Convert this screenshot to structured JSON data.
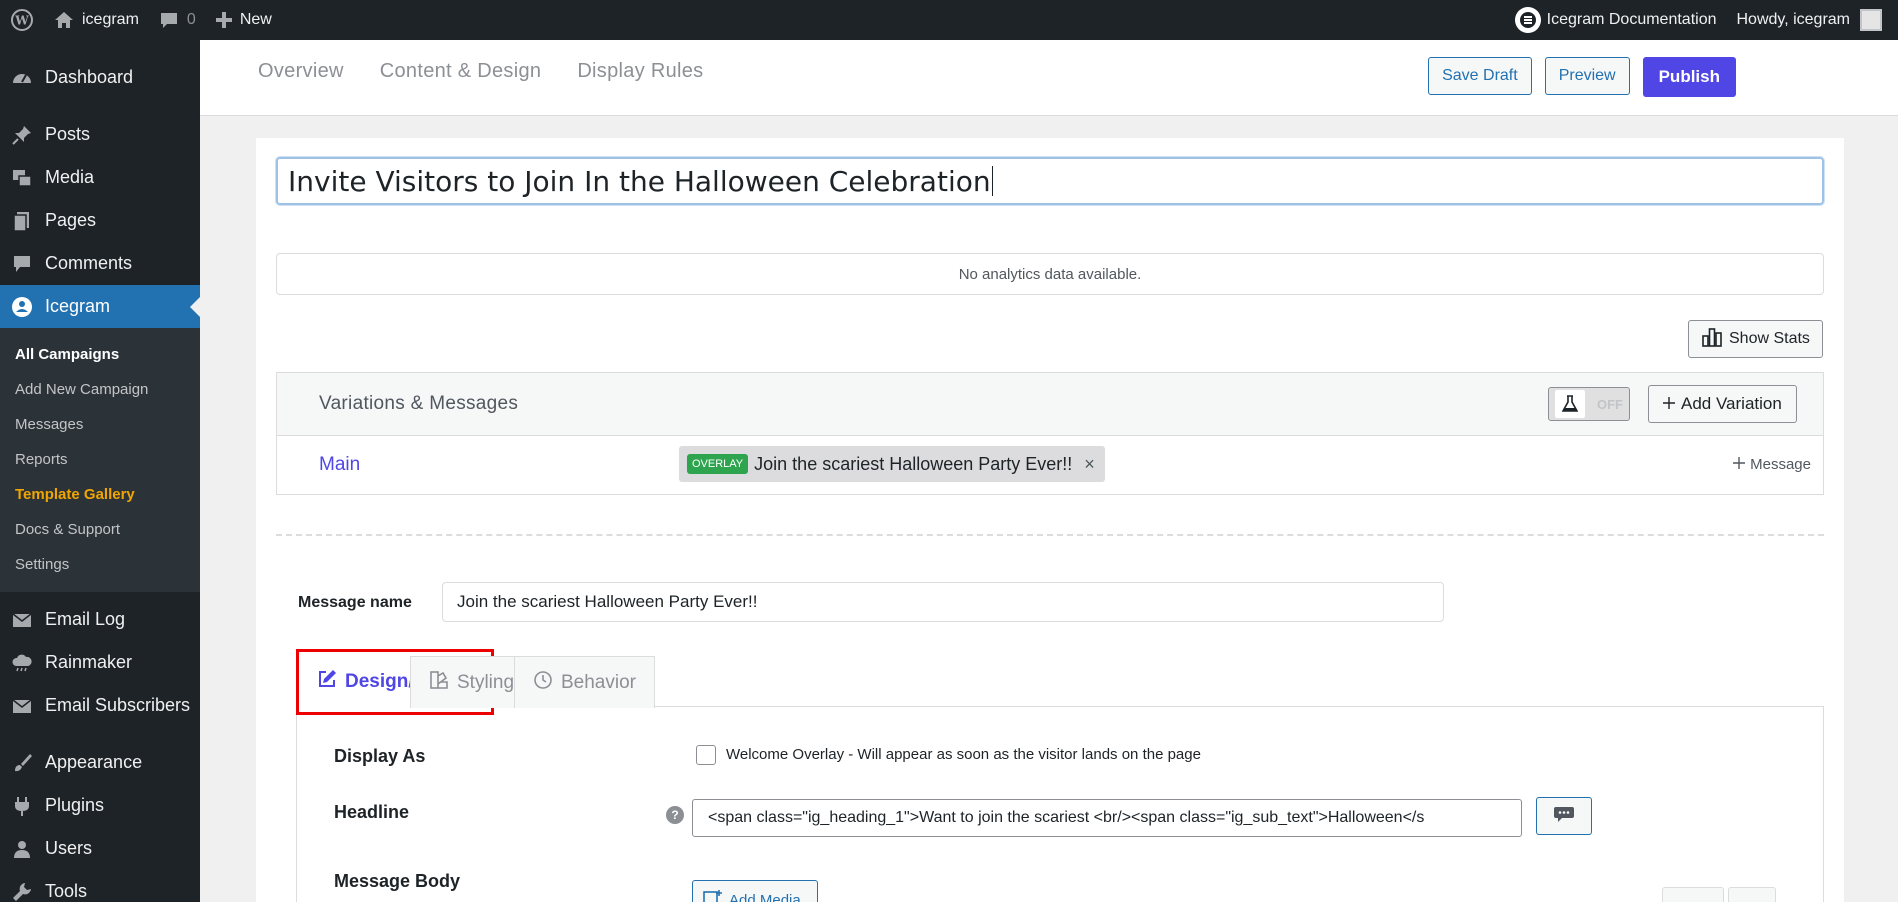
{
  "adminbar": {
    "site_name": "icegram",
    "comments_count": "0",
    "new_label": "New",
    "docs_label": "Icegram Documentation",
    "howdy": "Howdy, icegram"
  },
  "sidebar": {
    "items": [
      {
        "label": "Dashboard",
        "icon": "dashboard-icon"
      },
      {
        "label": "Posts",
        "icon": "pin-icon"
      },
      {
        "label": "Media",
        "icon": "media-icon"
      },
      {
        "label": "Pages",
        "icon": "pages-icon"
      },
      {
        "label": "Comments",
        "icon": "comment-icon"
      },
      {
        "label": "Icegram",
        "icon": "icegram-icon"
      },
      {
        "label": "Email Log",
        "icon": "email-icon"
      },
      {
        "label": "Rainmaker",
        "icon": "cloud-icon"
      },
      {
        "label": "Email Subscribers",
        "icon": "email-icon"
      },
      {
        "label": "Appearance",
        "icon": "brush-icon"
      },
      {
        "label": "Plugins",
        "icon": "plugin-icon"
      },
      {
        "label": "Users",
        "icon": "user-icon"
      },
      {
        "label": "Tools",
        "icon": "wrench-icon"
      }
    ],
    "submenu": [
      "All Campaigns",
      "Add New Campaign",
      "Messages",
      "Reports",
      "Template Gallery",
      "Docs & Support",
      "Settings"
    ]
  },
  "header": {
    "tabs": [
      "Overview",
      "Content & Design",
      "Display Rules"
    ],
    "save_draft": "Save Draft",
    "preview": "Preview",
    "publish": "Publish"
  },
  "campaign": {
    "title": "Invite Visitors to Join In the Halloween Celebration",
    "analytics_empty": "No analytics data available.",
    "show_stats": "Show Stats"
  },
  "variations": {
    "title": "Variations & Messages",
    "toggle_state": "OFF",
    "add_variation": "Add Variation",
    "main_label": "Main",
    "chip_badge": "OVERLAY",
    "chip_title": "Join the scariest Halloween Party Ever!!",
    "chip_close": "×",
    "add_message": "Message"
  },
  "message": {
    "name_label": "Message name",
    "name_value": "Join the scariest Halloween Party Ever!!",
    "tabs": [
      "Design/Create",
      "Styling",
      "Behavior"
    ],
    "display_as_label": "Display As",
    "display_as_option": "Welcome Overlay - Will appear as soon as the visitor lands on the page",
    "headline_label": "Headline",
    "headline_value": "<span class=\"ig_heading_1\">Want to join the scariest <br/><span class=\"ig_sub_text\">Halloween</s",
    "body_label": "Message Body",
    "add_media": "Add Media"
  },
  "colors": {
    "accent": "#4f46e5",
    "wp_blue": "#2271b1",
    "admin_dark": "#1d2327",
    "highlight_orange": "#f0a500",
    "focus_red": "#e00000"
  }
}
